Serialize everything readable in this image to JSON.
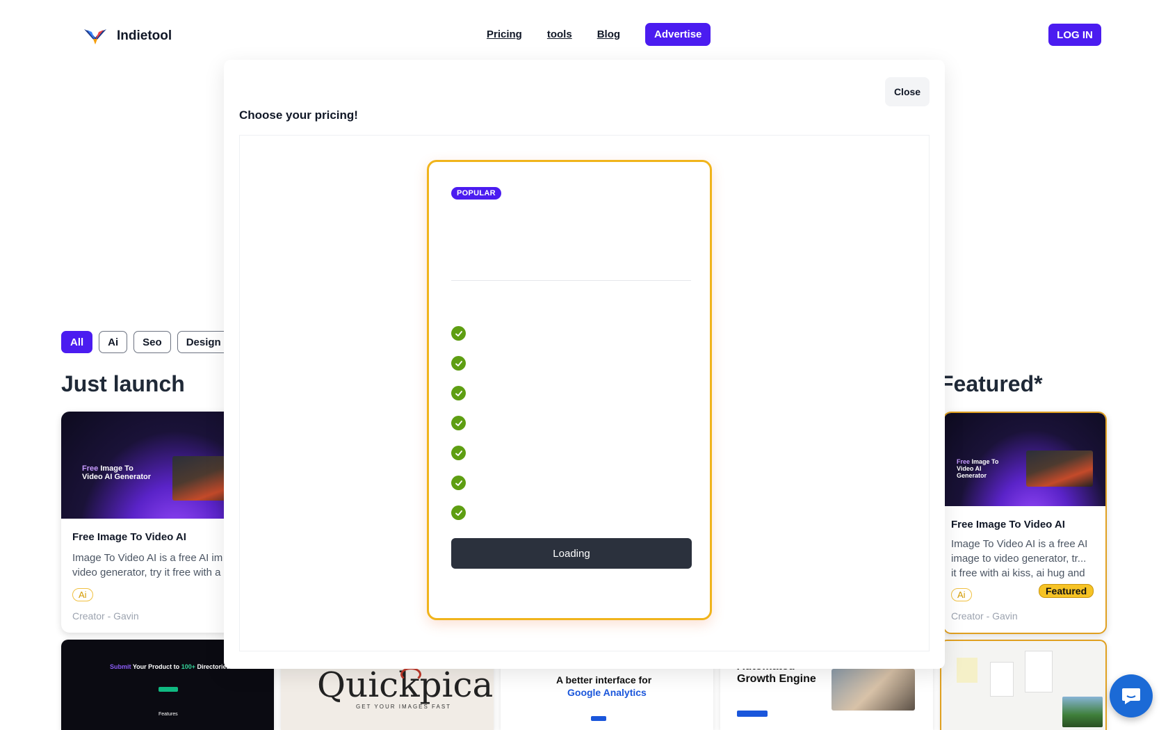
{
  "header": {
    "brand": "Indietool",
    "nav": [
      {
        "label": "Pricing"
      },
      {
        "label": "tools"
      },
      {
        "label": "Blog"
      },
      {
        "label": "Advertise"
      }
    ],
    "login": "LOG IN"
  },
  "filters": [
    "All",
    "Ai",
    "Seo",
    "Design"
  ],
  "sections": {
    "left_title": "Just launch",
    "right_title": "Featured*"
  },
  "left_card": {
    "thumb_title_highlight": "Free",
    "thumb_title": "Image To Video AI Generator",
    "title": "Free Image To Video AI",
    "desc_line1": "Image To Video AI is a free AI im",
    "desc_line2": "video generator, try it free with a",
    "tag": "Ai",
    "creator": "Creator - Gavin"
  },
  "featured_card": {
    "thumb_title_highlight": "Free",
    "thumb_title": "Image To Video AI Generator",
    "title": "Free Image To Video AI",
    "desc_line1": "Image To Video AI is a free AI",
    "desc_line2": "image to video generator, tr...",
    "desc_line3": "it free with ai kiss, ai hug and",
    "tag": "Ai",
    "badge": "Featured",
    "creator": "Creator - Gavin"
  },
  "modal": {
    "close": "Close",
    "heading": "Choose your pricing!",
    "popular_badge": "POPULAR",
    "check_count": 7,
    "button": "Loading"
  },
  "bottom_row": {
    "t1_title_hl": "Submit",
    "t1_title": "Your Product to",
    "t1_title_num": "100+",
    "t1_title_end": "Directories",
    "t1_features": "Features",
    "t2_brand": "Quickpicai",
    "t2_tag": "GET YOUR IMAGES FAST",
    "t3_line1": "A better interface for",
    "t3_line2": "Google Analytics",
    "t4_line1": "Automated",
    "t4_line2": "Growth Engine"
  },
  "colors": {
    "accent": "#4b1cf0",
    "featured_border": "#e0a020",
    "check_green": "#5e9e12",
    "dark_button": "#2b313d"
  },
  "icons": {
    "logo": "bird-logo-icon",
    "check": "checkmark-icon",
    "chat": "chat-bubble-icon"
  }
}
